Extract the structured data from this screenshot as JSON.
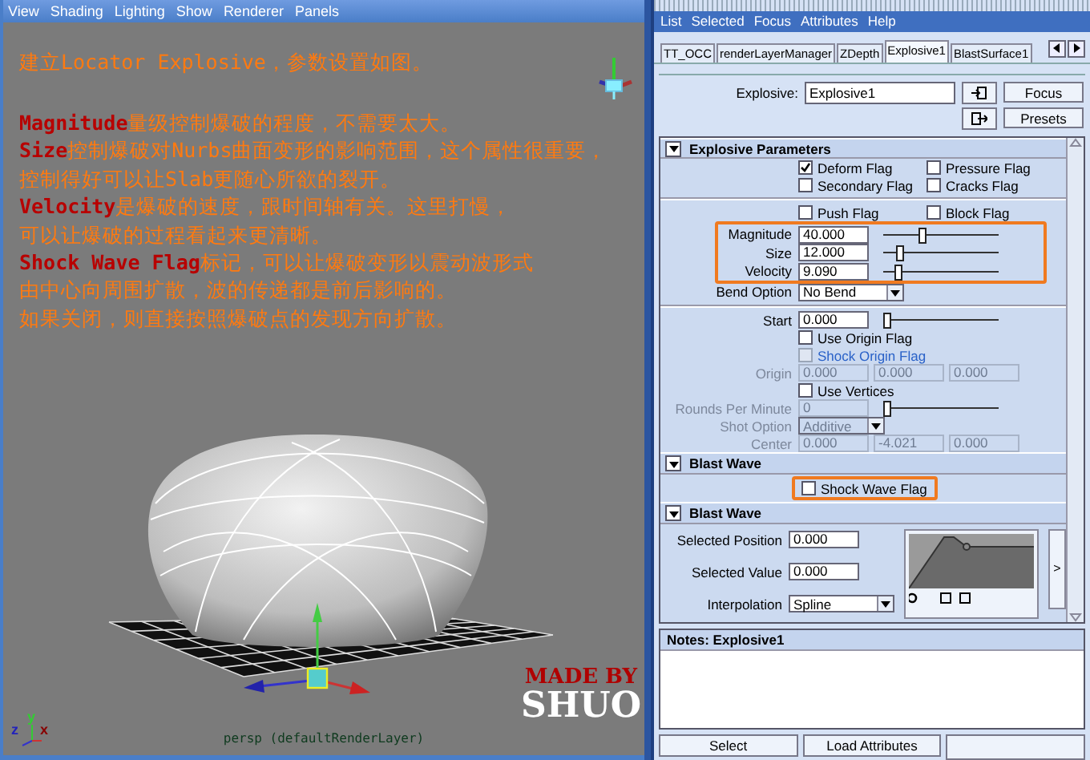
{
  "viewport": {
    "menu": [
      "View",
      "Shading",
      "Lighting",
      "Show",
      "Renderer",
      "Panels"
    ],
    "intro": "建立Locator Explosive，参数设置如图。",
    "points": [
      {
        "keyword": "Magnitude",
        "text": "量级控制爆破的程度，不需要太大。"
      },
      {
        "keyword": "Size",
        "text": "控制爆破对Nurbs曲面变形的影响范围，这个属性很重要，"
      },
      {
        "text": "控制得好可以让Slab更随心所欲的裂开。"
      },
      {
        "keyword": "Velocity",
        "text": "是爆破的速度，跟时间轴有关。这里打慢，"
      },
      {
        "text": "可以让爆破的过程看起来更清晰。"
      },
      {
        "keyword": "Shock Wave Flag",
        "text": "标记，可以让爆破变形以震动波形式"
      },
      {
        "text": "由中心向周围扩散，波的传递都是前后影响的。"
      },
      {
        "text": "如果关闭，则直接按照爆破点的发现方向扩散。"
      }
    ],
    "axis_labels": [
      "y",
      "z",
      "x"
    ],
    "signature": [
      "MADE BY",
      "SHUO"
    ],
    "camera_label": "persp (defaultRenderLayer)"
  },
  "attribute_editor": {
    "menu": [
      "List",
      "Selected",
      "Focus",
      "Attributes",
      "Help"
    ],
    "tabs": [
      {
        "label": "TT_OCC",
        "selected": false
      },
      {
        "label": "renderLayerManager",
        "selected": false
      },
      {
        "label": "ZDepth",
        "selected": false
      },
      {
        "label": "Explosive1",
        "selected": true
      },
      {
        "label": "BlastSurface1",
        "selected": false
      }
    ],
    "node": {
      "label": "Explosive:",
      "value": "Explosive1"
    },
    "buttons": [
      "Focus",
      "Presets"
    ],
    "sections": [
      {
        "title": "Explosive Parameters",
        "expanded": true,
        "rows": [
          {
            "kind": "checks",
            "items": [
              {
                "label": "Deform Flag",
                "checked": true,
                "disabled": false
              },
              {
                "label": "Pressure Flag",
                "checked": false,
                "disabled": false
              }
            ]
          },
          {
            "kind": "checks",
            "items": [
              {
                "label": "Secondary Flag",
                "checked": false,
                "disabled": false
              },
              {
                "label": "Cracks Flag",
                "checked": false,
                "disabled": false
              }
            ]
          },
          {
            "kind": "divider"
          },
          {
            "kind": "checks",
            "items": [
              {
                "label": "Push Flag",
                "checked": false,
                "disabled": false
              },
              {
                "label": "Block Flag",
                "checked": false,
                "disabled": false
              }
            ]
          },
          {
            "kind": "group",
            "highlighted": true,
            "rows": [
              {
                "kind": "field",
                "label": "Magnitude",
                "values": [
                  "40.000"
                ],
                "level": 0.28,
                "disabled": false
              },
              {
                "kind": "field",
                "label": "Size",
                "values": [
                  "12.000"
                ],
                "level": 0.1,
                "disabled": false
              },
              {
                "kind": "field",
                "label": "Velocity",
                "values": [
                  "9.090"
                ],
                "level": 0.09,
                "disabled": false
              }
            ]
          },
          {
            "kind": "dropdown",
            "label": "Bend Option",
            "value": "No Bend",
            "disabled": false
          },
          {
            "kind": "divider"
          },
          {
            "kind": "field",
            "label": "Start",
            "values": [
              "0.000"
            ],
            "level": 0.0,
            "disabled": false
          },
          {
            "kind": "checks",
            "items": [
              {
                "label": "Use Origin Flag",
                "checked": false,
                "disabled": false
              }
            ]
          },
          {
            "kind": "checks",
            "items": [
              {
                "label": "Shock Origin Flag",
                "checked": false,
                "disabled": true
              }
            ]
          },
          {
            "kind": "field",
            "label": "Origin",
            "values": [
              "0.000",
              "0.000",
              "0.000"
            ],
            "disabled": true
          },
          {
            "kind": "checks",
            "items": [
              {
                "label": "Use Vertices",
                "checked": false,
                "disabled": false
              }
            ]
          },
          {
            "kind": "field",
            "label": "Rounds Per Minute",
            "values": [
              "0"
            ],
            "level": 0.0,
            "disabled": true
          },
          {
            "kind": "dropdown",
            "label": "Shot Option",
            "value": "Additive",
            "disabled": true
          },
          {
            "kind": "field",
            "label": "Center",
            "values": [
              "0.000",
              "-4.021",
              "0.000"
            ],
            "disabled": true
          }
        ]
      },
      {
        "title": "Blast Wave",
        "expanded": true,
        "rows": [
          {
            "kind": "group",
            "highlighted": true,
            "rows": [
              {
                "kind": "checks",
                "items": [
                  {
                    "label": "Shock Wave Flag",
                    "checked": false,
                    "disabled": false
                  }
                ]
              }
            ]
          }
        ]
      },
      {
        "title": "Blast Wave",
        "expanded": true,
        "rows": [
          {
            "kind": "ramp",
            "fields": [
              {
                "kind": "field",
                "label": "Selected Position",
                "values": [
                  "0.000"
                ],
                "disabled": false
              },
              {
                "kind": "field",
                "label": "Selected Value",
                "values": [
                  "0.000"
                ],
                "disabled": false
              },
              {
                "kind": "dropdown",
                "label": "Interpolation",
                "value": "Spline",
                "disabled": false
              }
            ],
            "expand_button": ">"
          }
        ]
      }
    ],
    "notes": {
      "title": "Notes: Explosive1"
    },
    "bottom_buttons": [
      "Select",
      "Load Attributes"
    ]
  }
}
